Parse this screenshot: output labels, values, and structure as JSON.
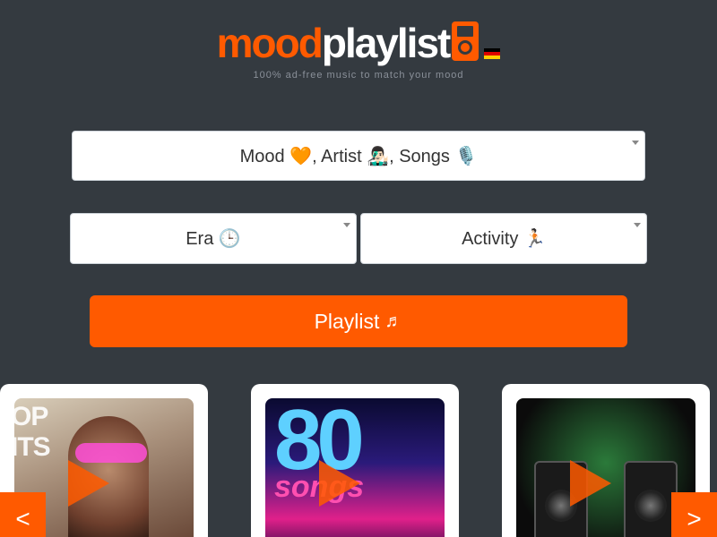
{
  "header": {
    "logo_part1": "mood",
    "logo_part2": "playlist",
    "tagline": "100% ad-free music to match your mood",
    "language_flag": "de"
  },
  "selects": {
    "main": {
      "label": "Mood 🧡, Artist 👨🏻‍🎤, Songs 🎙️"
    },
    "era": {
      "label": "Era 🕒"
    },
    "activity": {
      "label": "Activity 🏃🏻"
    }
  },
  "submit_button": {
    "label": "Playlist",
    "icon": "music-note-icon"
  },
  "playlist_cards": [
    {
      "name": "pop-hits",
      "art_text": "OP\nITS"
    },
    {
      "name": "80s-songs",
      "art_text_top": "80",
      "art_text_bottom": "songs"
    },
    {
      "name": "dj-speakers"
    }
  ],
  "carousel": {
    "prev_label": "<",
    "next_label": ">"
  },
  "colors": {
    "background": "#343a40",
    "accent": "#ff5a00",
    "white": "#ffffff"
  }
}
